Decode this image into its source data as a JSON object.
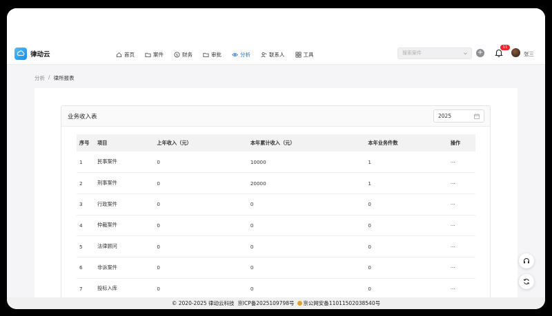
{
  "app": {
    "name": "律动云"
  },
  "nav": {
    "items": [
      {
        "label": "首页",
        "icon": "home-icon"
      },
      {
        "label": "案件",
        "icon": "folder-icon"
      },
      {
        "label": "财务",
        "icon": "dollar-icon"
      },
      {
        "label": "审批",
        "icon": "folder-icon"
      },
      {
        "label": "分析",
        "icon": "eye-icon",
        "active": true
      },
      {
        "label": "联系人",
        "icon": "contacts-icon"
      },
      {
        "label": "工具",
        "icon": "tools-icon"
      }
    ],
    "active_color": "#1f6fe5"
  },
  "search": {
    "placeholder": "搜索案件"
  },
  "notifications": {
    "count": "11"
  },
  "user": {
    "name": "张三"
  },
  "breadcrumb": {
    "parent": "分析",
    "separator": "/",
    "current": "律所报表"
  },
  "card": {
    "title": "业务收入表",
    "year": "2025"
  },
  "table": {
    "headers": [
      "序号",
      "项目",
      "上年收入（元）",
      "本年累计收入（元）",
      "本年业务件数",
      "操作"
    ],
    "rows": [
      [
        "1",
        "民事案件",
        "0",
        "10000",
        "1",
        "···"
      ],
      [
        "2",
        "刑事案件",
        "0",
        "20000",
        "1",
        "···"
      ],
      [
        "3",
        "行政案件",
        "0",
        "0",
        "0",
        "···"
      ],
      [
        "4",
        "仲裁案件",
        "0",
        "0",
        "0",
        "···"
      ],
      [
        "5",
        "法律顾问",
        "0",
        "0",
        "0",
        "···"
      ],
      [
        "6",
        "非诉案件",
        "0",
        "0",
        "0",
        "···"
      ],
      [
        "7",
        "投标入库",
        "0",
        "0",
        "0",
        "···"
      ]
    ]
  },
  "footer": {
    "copyright": "© 2020-2025 律动云科技",
    "icp": "京ICP备2025109798号",
    "police": "京公网安备11011502038540号"
  },
  "floating": [
    {
      "icon": "headset-icon"
    },
    {
      "icon": "refresh-icon"
    }
  ]
}
